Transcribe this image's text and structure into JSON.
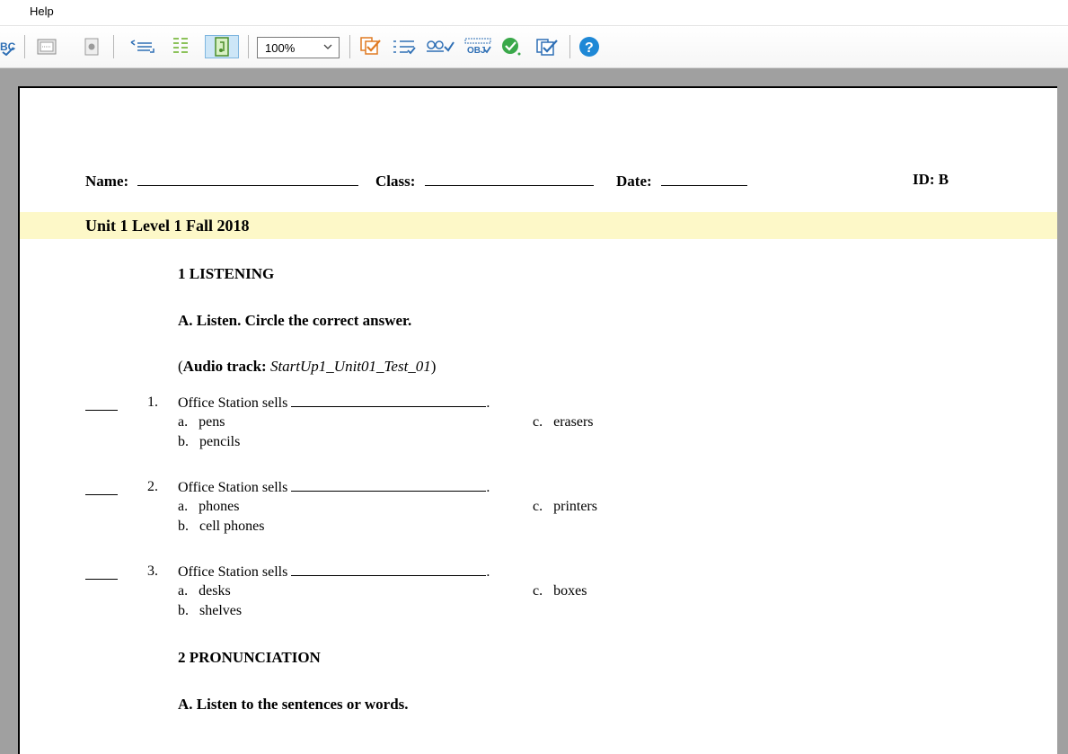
{
  "menu": {
    "help_label": "Help"
  },
  "toolbar": {
    "zoom_value": "100%",
    "icons": [
      "spellcheck-icon",
      "keypad-icon",
      "record-icon",
      "indent-icon",
      "list-icon",
      "page-view-icon",
      "answer-key-icon",
      "numbered-list-icon",
      "spell-check-icon",
      "objective-icon",
      "check-icon",
      "checklist-icon",
      "help-icon"
    ]
  },
  "header": {
    "name_label": "Name:",
    "class_label": "Class:",
    "date_label": "Date:",
    "id_label": "ID: B"
  },
  "unit_title": "Unit 1 Level 1 Fall 2018",
  "section1": {
    "title": "1 LISTENING",
    "instruction": "A. Listen. Circle the correct answer.",
    "audio_prefix": "(",
    "audio_label": "Audio track:",
    "audio_track": "StartUp1_Unit01_Test_01",
    "audio_suffix": ")"
  },
  "questions": [
    {
      "num": "1.",
      "text": "Office Station sells",
      "a": "pens",
      "b": "pencils",
      "c": "erasers"
    },
    {
      "num": "2.",
      "text": "Office Station sells",
      "a": "phones",
      "b": "cell phones",
      "c": "printers"
    },
    {
      "num": "3.",
      "text": "Office Station sells",
      "a": "desks",
      "b": "shelves",
      "c": "boxes"
    }
  ],
  "option_letters": {
    "a": "a.",
    "b": "b.",
    "c": "c."
  },
  "section2": {
    "title": "2 PRONUNCIATION",
    "instruction": "A. Listen to the sentences or words."
  }
}
